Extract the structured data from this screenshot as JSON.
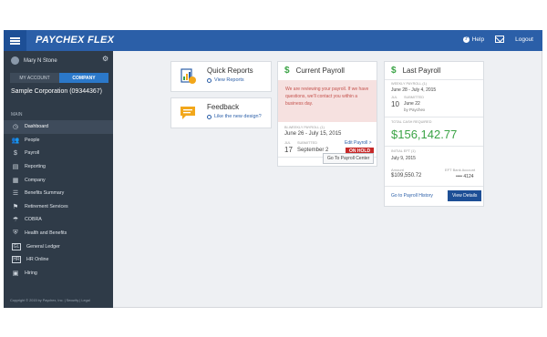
{
  "header": {
    "brand": "PAYCHEX FLEX",
    "help": "Help",
    "logout": "Logout"
  },
  "sidebar": {
    "user_name": "Mary N Stone",
    "tabs": {
      "my_account": "MY ACCOUNT",
      "company": "COMPANY"
    },
    "corporation": "Sample Corporation (09344367)",
    "section_label": "MAIN",
    "items": [
      {
        "label": "Dashboard",
        "icon": "dashboard-icon"
      },
      {
        "label": "People",
        "icon": "people-icon"
      },
      {
        "label": "Payroll",
        "icon": "dollar-icon"
      },
      {
        "label": "Reporting",
        "icon": "reporting-icon"
      },
      {
        "label": "Company",
        "icon": "company-icon"
      },
      {
        "label": "Benefits Summary",
        "icon": "benefits-icon"
      },
      {
        "label": "Retirement Services",
        "icon": "retirement-icon"
      },
      {
        "label": "COBRA",
        "icon": "cobra-icon"
      },
      {
        "label": "Health and Benefits",
        "icon": "shield-icon"
      },
      {
        "label": "General Ledger",
        "icon": "gl-icon"
      },
      {
        "label": "HR Online",
        "icon": "hr-icon"
      },
      {
        "label": "Hiring",
        "icon": "hiring-icon"
      }
    ],
    "copyright": "Copyright © 2015 by Paychex, Inc. | Security | Legal"
  },
  "quick_reports": {
    "title": "Quick Reports",
    "link": "View Reports"
  },
  "feedback": {
    "title": "Feedback",
    "link": "Like the new design?"
  },
  "current_payroll": {
    "title": "Current Payroll",
    "alert": "We are reviewing your payroll. If we have questions, we'll contact you within a business day.",
    "period_label": "BI-WEEKLY PAYROLL (1)",
    "period": "June 26 - July 15, 2015",
    "month": "JUL",
    "day": "17",
    "submitted_label": "SUBMITTED",
    "submitted_date": "September 2",
    "edit_link": "Edit Payroll >",
    "status": "ON HOLD",
    "button": "Go To Payroll Center"
  },
  "last_payroll": {
    "title": "Last Payroll",
    "period_label": "WEEKLY PAYROLL (1)",
    "period": "June 28 - July 4, 2015",
    "month": "JUL",
    "day": "10",
    "submitted_label": "SUBMITTED",
    "submitted_date": "June 22",
    "submitted_by": "by Paychex",
    "total_label": "TOTAL CASH REQUIRED",
    "total": "$156,142.77",
    "initial_label": "INITIAL EFT (1)",
    "initial_date": "July 9, 2015",
    "amount_label": "Amount",
    "amount": "$109,550.72",
    "account_label": "EFT Bank Account",
    "account": "•••• 4124",
    "history_link": "Go to Payroll History",
    "details_button": "View Details"
  }
}
